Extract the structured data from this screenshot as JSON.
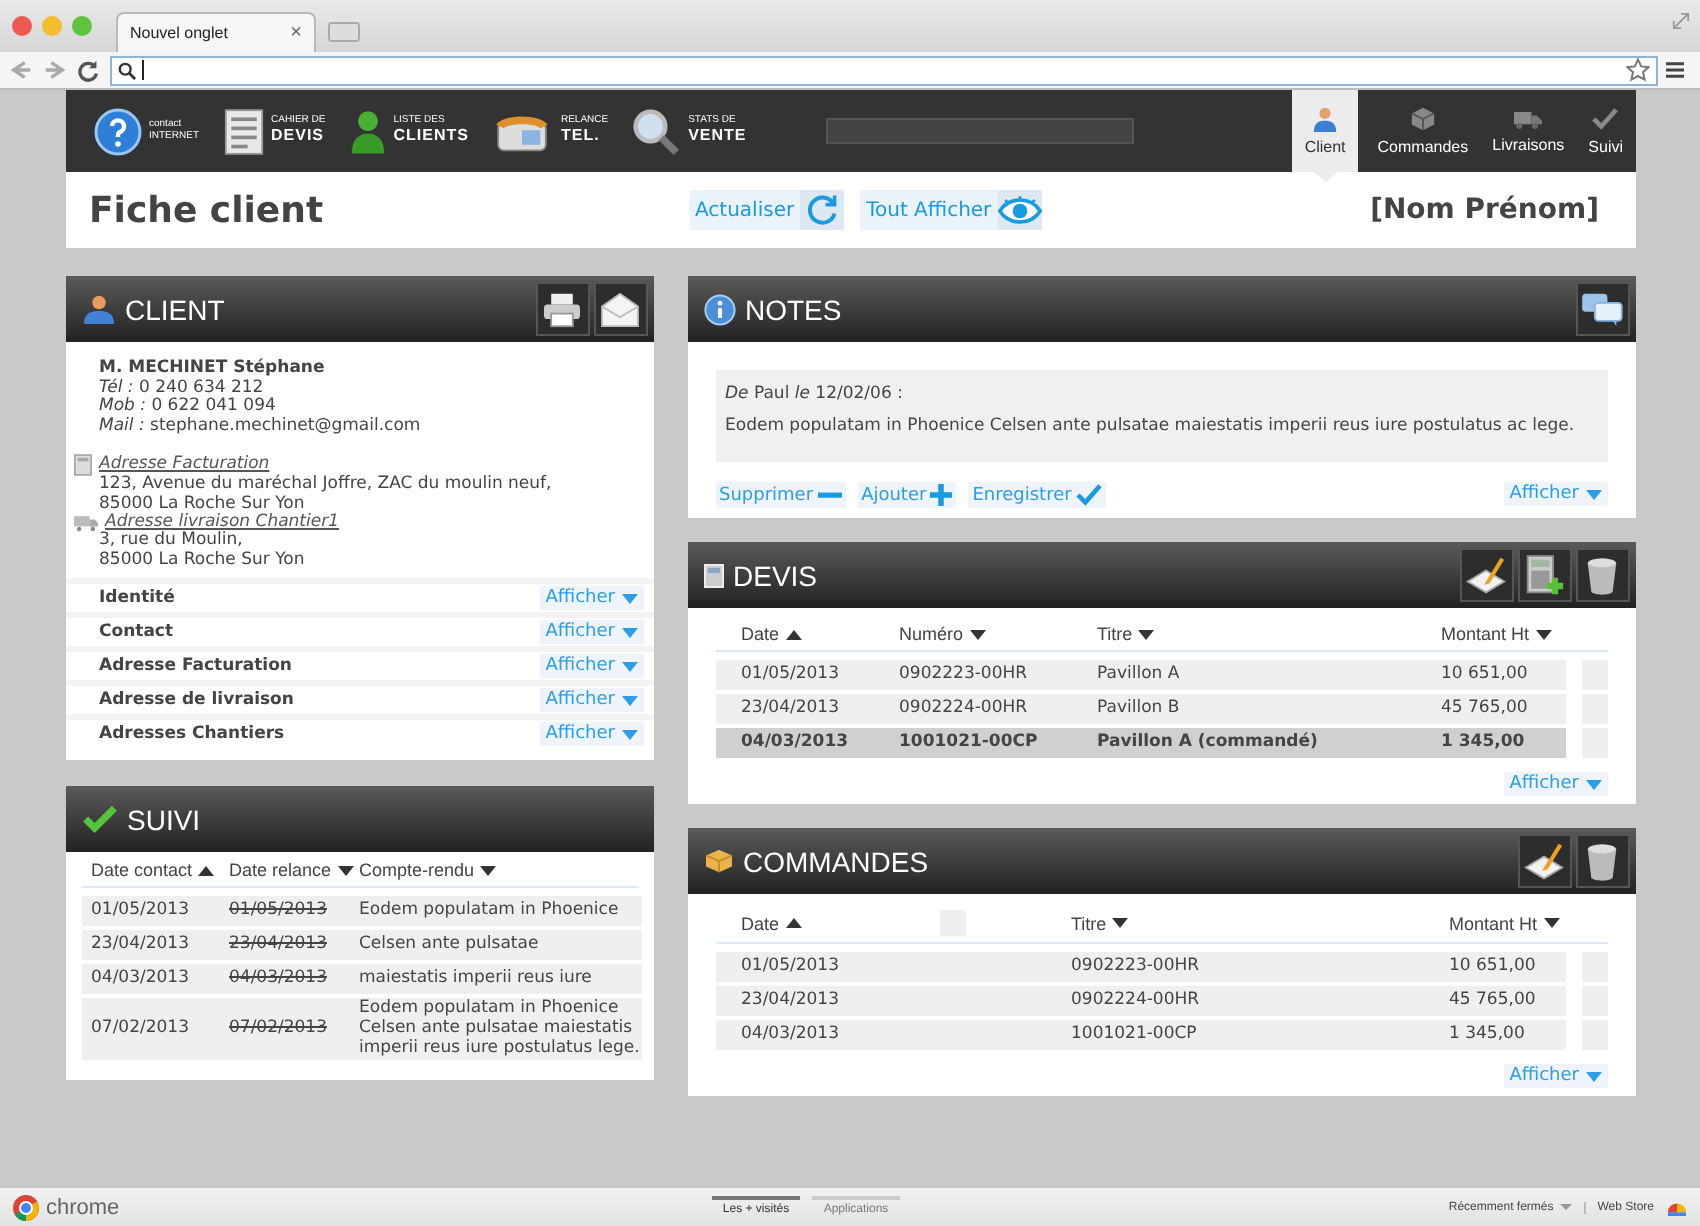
{
  "browser": {
    "tab_title": "Nouvel onglet",
    "tab_close": "×"
  },
  "nav": {
    "shortcuts": [
      {
        "kind": "help",
        "line1": "contact",
        "line2": "INTERNET"
      },
      {
        "kind": "doc",
        "line1": "CAHIER DE",
        "line2": "DEVIS"
      },
      {
        "kind": "person",
        "line1": "LISTE DES",
        "line2": "CLIENTS"
      },
      {
        "kind": "phone",
        "line1": "RELANCE",
        "line2": "TEL."
      },
      {
        "kind": "magnifier",
        "line1": "STATS DE",
        "line2": "VENTE"
      }
    ],
    "tabs": [
      {
        "kind": "person",
        "label": "Client",
        "selected": true
      },
      {
        "kind": "box",
        "label": "Commandes",
        "selected": false
      },
      {
        "kind": "truck",
        "label": "Livraisons",
        "selected": false
      },
      {
        "kind": "check",
        "label": "Suivi",
        "selected": false
      }
    ]
  },
  "header": {
    "title": "Fiche client",
    "actions": [
      {
        "kind": "refresh",
        "label": "Actualiser"
      },
      {
        "kind": "eye",
        "label": "Tout Afficher"
      }
    ],
    "client_name": "[Nom Prénom]"
  },
  "client": {
    "title": "CLIENT",
    "tools": [
      {
        "kind": "print"
      },
      {
        "kind": "mail"
      }
    ],
    "name": "M. MECHINET Stéphane",
    "contacts": [
      "*Tél :*   0 240 634 212",
      "*Mob :* 0 622 041 094",
      "*Mail :* stephane.mechinet@gmail.com"
    ],
    "addresses": [
      {
        "kind": "calc",
        "label": "Adresse Facturation",
        "lines": [
          "123, Avenue du maréchal Joffre, ZAC du moulin neuf,",
          "85000 La Roche Sur Yon"
        ]
      },
      {
        "kind": "truck",
        "label": "Adresse livraison Chantier1",
        "lines": [
          "3, rue du Moulin,",
          "85000 La Roche Sur Yon"
        ]
      }
    ],
    "sections": [
      {
        "label": "Identité",
        "action": "Afficher"
      },
      {
        "label": "Contact",
        "action": "Afficher"
      },
      {
        "label": "Adresse Facturation",
        "action": "Afficher"
      },
      {
        "label": "Adresse de livraison",
        "action": "Afficher"
      },
      {
        "label": "Adresses Chantiers",
        "action": "Afficher"
      }
    ]
  },
  "suivi": {
    "title": "SUIVI",
    "columns": [
      {
        "label": "Date contact",
        "ascending": true
      },
      {
        "label": "Date relance",
        "ascending": false
      },
      {
        "label": "Compte-rendu",
        "ascending": false
      }
    ],
    "rows": [
      {
        "date_contact": "01/05/2013",
        "date_relance": "01/05/2013",
        "compte_rendu": "Eodem populatam in Phoenice"
      },
      {
        "date_contact": "23/04/2013",
        "date_relance": "23/04/2013",
        "compte_rendu": "Celsen ante pulsatae"
      },
      {
        "date_contact": "04/03/2013",
        "date_relance": "04/03/2013",
        "compte_rendu": "maiestatis imperii reus iure"
      },
      {
        "date_contact": "07/02/2013",
        "date_relance": "07/02/2013",
        "compte_rendu": "Eodem populatam in Phoenice Celsen ante pulsatae maiestatis imperii reus iure postulatus lege."
      }
    ]
  },
  "notes": {
    "title": "NOTES",
    "tools": [
      {
        "kind": "chat"
      }
    ],
    "note_header": "*De* Paul *le* 12/02/06 :",
    "note_text": "Eodem populatam in Phoenice Celsen ante pulsatae maiestatis imperii reus iure postulatus ac lege.",
    "actions": [
      {
        "kind": "minus",
        "label": "Supprimer"
      },
      {
        "kind": "plus",
        "label": "Ajouter"
      },
      {
        "kind": "check",
        "label": "Enregistrer"
      }
    ],
    "more": "Afficher"
  },
  "devis": {
    "title": "DEVIS",
    "tools": [
      {
        "kind": "edit"
      },
      {
        "kind": "calc-add"
      },
      {
        "kind": "trash"
      }
    ],
    "columns": [
      {
        "label": "Date",
        "ascending": true
      },
      {
        "label": "Numéro",
        "ascending": false
      },
      {
        "label": "Titre",
        "ascending": false
      },
      {
        "label": "Montant Ht",
        "ascending": false
      }
    ],
    "rows": [
      {
        "cells": [
          "01/05/2013",
          "0902223-00HR",
          "Pavillon A",
          "10 651,00"
        ],
        "selected": false,
        "checked": false
      },
      {
        "cells": [
          "23/04/2013",
          "0902224-00HR",
          "Pavillon B",
          "45 765,00"
        ],
        "selected": false,
        "checked": false
      },
      {
        "cells": [
          "04/03/2013",
          "1001021-00CP",
          "Pavillon A (commandé)",
          "1 345,00"
        ],
        "selected": true,
        "checked": false
      }
    ],
    "more": "Afficher"
  },
  "commandes": {
    "title": "COMMANDES",
    "tools": [
      {
        "kind": "edit"
      },
      {
        "kind": "trash"
      }
    ],
    "columns": [
      {
        "label": "Date",
        "ascending": true
      },
      {
        "label": "Titre",
        "ascending": false
      },
      {
        "label": "Montant Ht",
        "ascending": false
      }
    ],
    "header_checked": false,
    "rows": [
      {
        "cells": [
          "01/05/2013",
          "0902223-00HR",
          "10 651,00"
        ],
        "checked": false
      },
      {
        "cells": [
          "23/04/2013",
          "0902224-00HR",
          "45 765,00"
        ],
        "checked": false
      },
      {
        "cells": [
          "04/03/2013",
          "1001021-00CP",
          "1 345,00"
        ],
        "checked": false
      }
    ],
    "more": "Afficher"
  },
  "bottom_bar": {
    "logo": "chrome",
    "tabs": [
      {
        "label": "Les + visités",
        "selected": true
      },
      {
        "label": "Applications",
        "selected": false
      }
    ],
    "recent": "Récemment fermés",
    "store": "Web Store"
  }
}
